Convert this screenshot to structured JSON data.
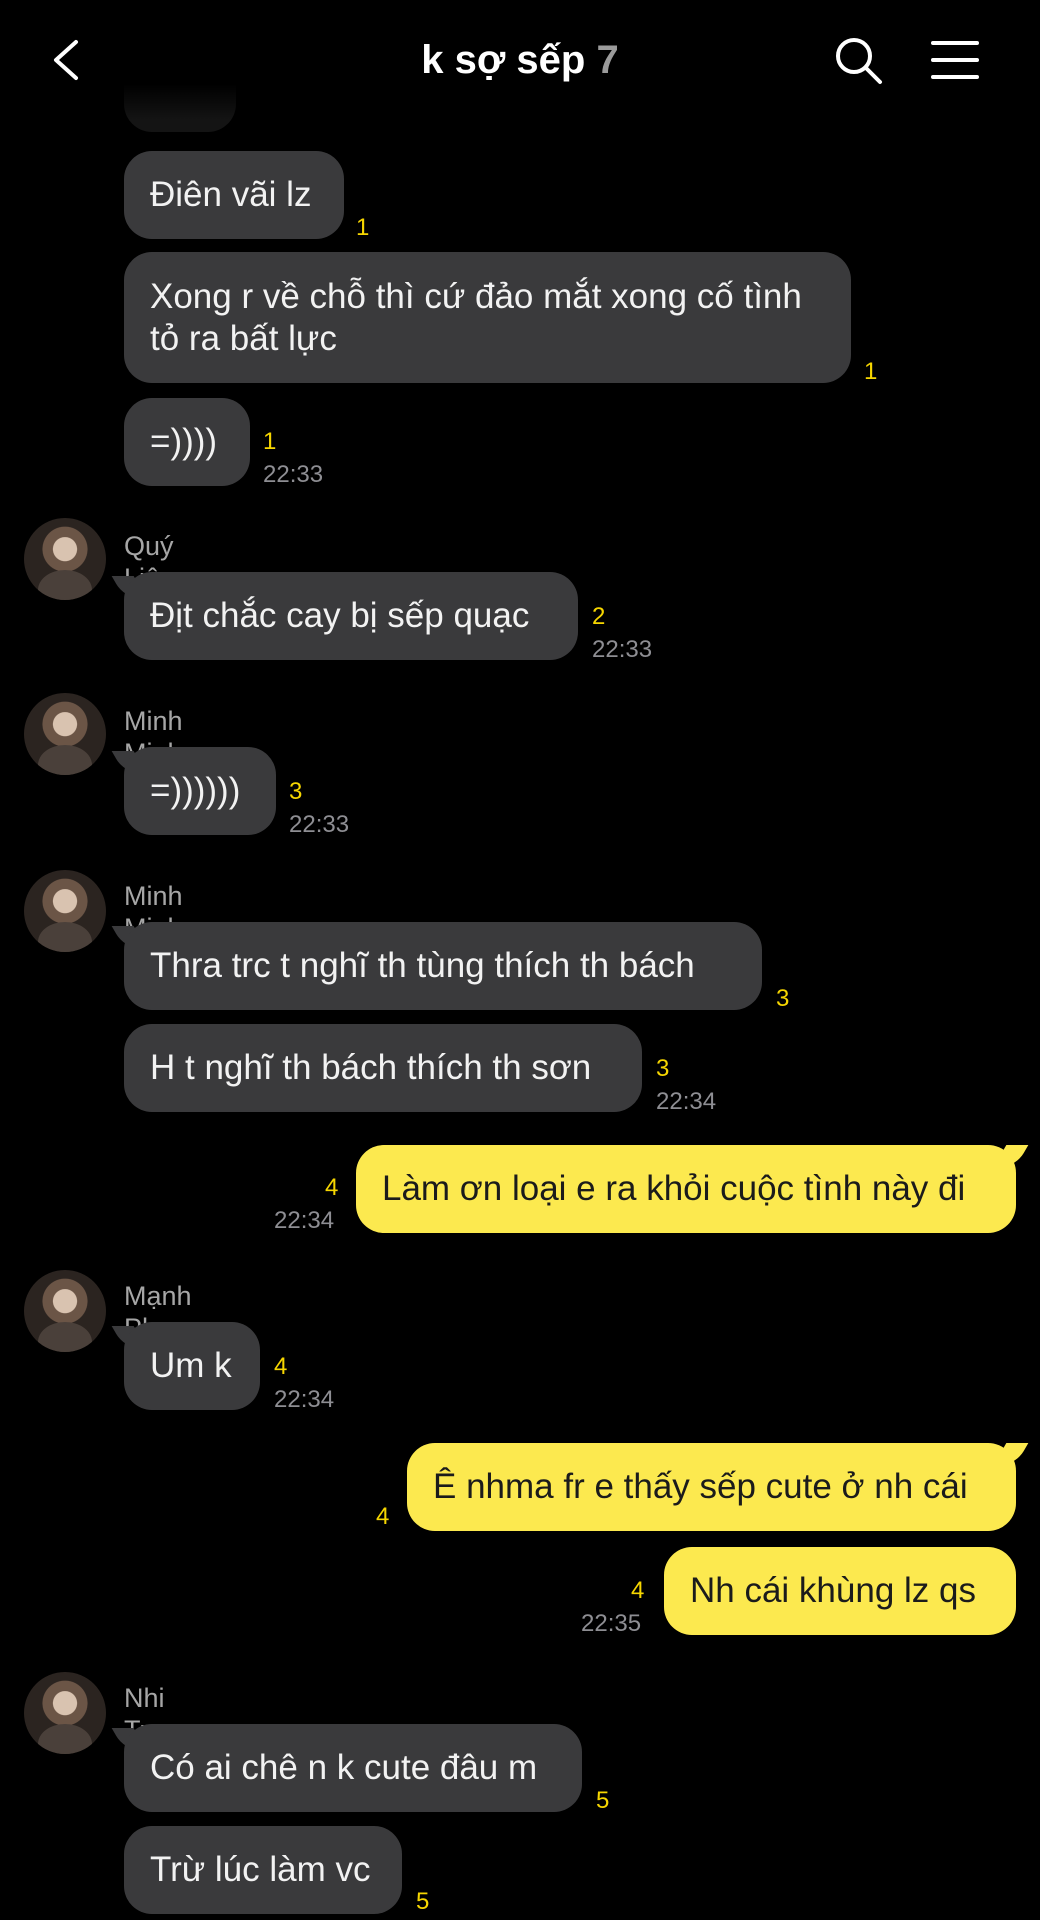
{
  "header": {
    "title": "k sợ sếp",
    "member_count": "7",
    "back_icon": "chevron-left-icon",
    "search_icon": "search-icon",
    "menu_icon": "hamburger-menu-icon"
  },
  "colors": {
    "background": "#000000",
    "incoming_bubble": "#3a3a3c",
    "outgoing_bubble": "#fce94f",
    "unread_count": "#f6d600",
    "timestamp": "#8e8e93",
    "sender_name": "#a6a6a6"
  },
  "messages": [
    {
      "text": "Điên vãi lz",
      "unread": "1"
    },
    {
      "text": "Xong r về chỗ thì cứ đảo mắt xong cố tình tỏ ra bất lực",
      "unread": "1"
    },
    {
      "text": "=))))",
      "unread": "1",
      "time": "22:33"
    },
    {
      "sender": "Quý Liêm",
      "text": "Địt chắc cay bị sếp quạc",
      "unread": "2",
      "time": "22:33"
    },
    {
      "sender": "Minh Minh",
      "text": "=))))))",
      "unread": "3",
      "time": "22:33"
    },
    {
      "sender": "Minh Minh",
      "text": "Thra trc t nghĩ th tùng thích th bách",
      "unread": "3"
    },
    {
      "text": "H t nghĩ th bách thích th sơn",
      "unread": "3",
      "time": "22:34"
    },
    {
      "text": "Làm ơn loại e ra khỏi cuộc tình này đi",
      "unread": "4",
      "time": "22:34",
      "outgoing": true
    },
    {
      "sender": "Mạnh Ph",
      "text": "Um k",
      "unread": "4",
      "time": "22:34"
    },
    {
      "text": "Ê nhma fr e thấy sếp cute ở nh cái",
      "unread": "4",
      "outgoing": true
    },
    {
      "text": "Nh cái khùng lz qs",
      "unread": "4",
      "time": "22:35",
      "outgoing": true
    },
    {
      "sender": "Nhi Tr",
      "text": "Có ai chê n k cute đâu m",
      "unread": "5"
    },
    {
      "text": "Trừ lúc làm vc",
      "unread": "5"
    }
  ]
}
